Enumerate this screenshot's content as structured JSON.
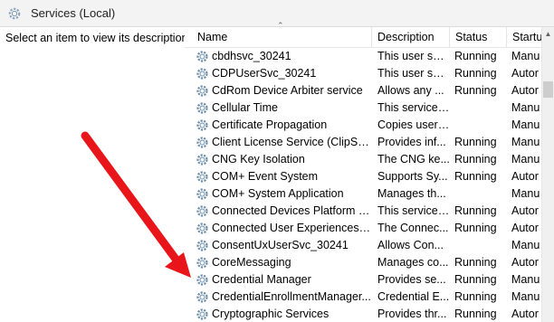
{
  "window": {
    "title": "Services (Local)"
  },
  "left_pane": {
    "description": "Select an item to view its description."
  },
  "columns": {
    "name": "Name",
    "description": "Description",
    "status": "Status",
    "startup": "Startu"
  },
  "services": [
    {
      "name": "cbdhsvc_30241",
      "description": "This user ser...",
      "status": "Running",
      "startup": "Manu"
    },
    {
      "name": "CDPUserSvc_30241",
      "description": "This user ser...",
      "status": "Running",
      "startup": "Autor"
    },
    {
      "name": "CdRom Device Arbiter service",
      "description": "Allows any ...",
      "status": "Running",
      "startup": "Autor"
    },
    {
      "name": "Cellular Time",
      "description": "This service ...",
      "status": "",
      "startup": "Manu"
    },
    {
      "name": "Certificate Propagation",
      "description": "Copies user ...",
      "status": "",
      "startup": "Manu"
    },
    {
      "name": "Client License Service (ClipSVC)",
      "description": "Provides inf...",
      "status": "Running",
      "startup": "Manu"
    },
    {
      "name": "CNG Key Isolation",
      "description": "The CNG ke...",
      "status": "Running",
      "startup": "Manu"
    },
    {
      "name": "COM+ Event System",
      "description": "Supports Sy...",
      "status": "Running",
      "startup": "Autor"
    },
    {
      "name": "COM+ System Application",
      "description": "Manages th...",
      "status": "",
      "startup": "Manu"
    },
    {
      "name": "Connected Devices Platform Se...",
      "description": "This service ...",
      "status": "Running",
      "startup": "Autor"
    },
    {
      "name": "Connected User Experiences an...",
      "description": "The Connec...",
      "status": "Running",
      "startup": "Autor"
    },
    {
      "name": "ConsentUxUserSvc_30241",
      "description": "Allows Con...",
      "status": "",
      "startup": "Manu"
    },
    {
      "name": "CoreMessaging",
      "description": "Manages co...",
      "status": "Running",
      "startup": "Autor"
    },
    {
      "name": "Credential Manager",
      "description": "Provides se...",
      "status": "Running",
      "startup": "Manu"
    },
    {
      "name": "CredentialEnrollmentManager...",
      "description": "Credential E...",
      "status": "Running",
      "startup": "Manu"
    },
    {
      "name": "Cryptographic Services",
      "description": "Provides thr...",
      "status": "Running",
      "startup": "Autor"
    }
  ],
  "icons": {
    "title": "services-gear-icon",
    "row": "service-gear-icon",
    "annotation": "red-arrow-pointer"
  },
  "colors": {
    "annotation_arrow": "#e8161b",
    "gear": "#6c8ca8"
  }
}
